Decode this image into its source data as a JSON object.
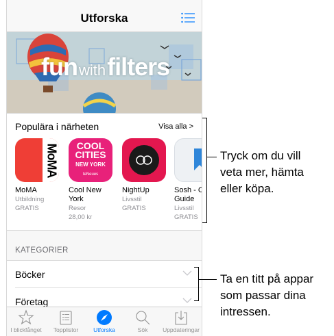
{
  "nav": {
    "title": "Utforska"
  },
  "banner": {
    "word1": "fun",
    "word2": "with",
    "word3": "filters"
  },
  "popular": {
    "title": "Populära i närheten",
    "see_all": "Visa alla >",
    "apps": [
      {
        "name": "MoMA",
        "category": "Utbildning",
        "price": "GRATIS",
        "icon_text": "MoMA"
      },
      {
        "name": "Cool New York",
        "category": "Resor",
        "price": "28,00 kr",
        "icon_line1": "COOL",
        "icon_line2": "CITIES",
        "icon_line3": "NEW YORK",
        "icon_line4": "teNeues"
      },
      {
        "name": "NightUp",
        "category": "Livsstil",
        "price": "GRATIS"
      },
      {
        "name": "Sosh - C Guide",
        "category": "Livsstil",
        "price": "GRATIS"
      }
    ]
  },
  "categories": {
    "header": "KATEGORIER",
    "items": [
      "Böcker",
      "Företag"
    ]
  },
  "tabs": [
    {
      "label": "I blickfånget",
      "icon": "star-icon"
    },
    {
      "label": "Topplistor",
      "icon": "list-icon"
    },
    {
      "label": "Utforska",
      "icon": "compass-icon",
      "active": true
    },
    {
      "label": "Sök",
      "icon": "search-icon"
    },
    {
      "label": "Uppdateringar",
      "icon": "download-icon"
    }
  ],
  "callouts": {
    "first": [
      "Tryck om du vill",
      "veta mer, hämta",
      "eller köpa."
    ],
    "second": [
      "Ta en titt på appar",
      "som passar dina",
      "intressen."
    ]
  },
  "colors": {
    "accent": "#007aff",
    "moma": "#ef3e36",
    "coolcities": "#e8217a",
    "nightup": "#e3174f"
  }
}
